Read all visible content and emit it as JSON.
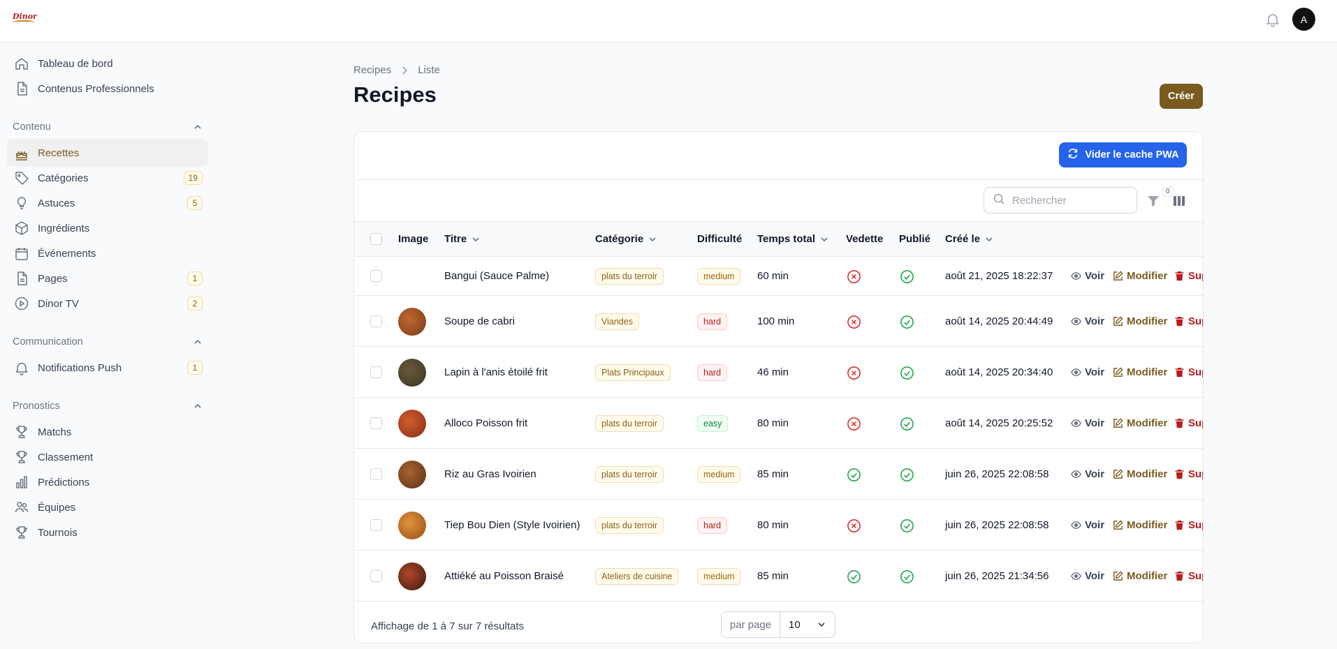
{
  "app": {
    "logo_text": "Dinor",
    "avatar_initial": "A"
  },
  "sidebar": {
    "top_items": [
      {
        "label": "Tableau de bord",
        "icon": "home-icon"
      },
      {
        "label": "Contenus Professionnels",
        "icon": "document-icon"
      }
    ],
    "groups": [
      {
        "label": "Contenu",
        "items": [
          {
            "label": "Recettes",
            "icon": "cake-icon",
            "active": true
          },
          {
            "label": "Catégories",
            "icon": "tag-icon",
            "badge": "19"
          },
          {
            "label": "Astuces",
            "icon": "lightbulb-icon",
            "badge": "5"
          },
          {
            "label": "Ingrédients",
            "icon": "cube-icon"
          },
          {
            "label": "Événements",
            "icon": "calendar-icon"
          },
          {
            "label": "Pages",
            "icon": "document-icon",
            "badge": "1"
          },
          {
            "label": "Dinor TV",
            "icon": "play-icon",
            "badge": "2"
          }
        ]
      },
      {
        "label": "Communication",
        "items": [
          {
            "label": "Notifications Push",
            "icon": "bell-icon",
            "badge": "1"
          }
        ]
      },
      {
        "label": "Pronostics",
        "items": [
          {
            "label": "Matchs",
            "icon": "trophy-icon"
          },
          {
            "label": "Classement",
            "icon": "trophy-icon"
          },
          {
            "label": "Prédictions",
            "icon": "bar-chart-icon"
          },
          {
            "label": "Équipes",
            "icon": "users-icon"
          },
          {
            "label": "Tournois",
            "icon": "trophy-icon"
          }
        ]
      }
    ]
  },
  "breadcrumb": {
    "root": "Recipes",
    "current": "Liste"
  },
  "page": {
    "title": "Recipes",
    "create_label": "Créer"
  },
  "card": {
    "pwa_button": "Vider le cache PWA",
    "search_placeholder": "Rechercher",
    "filter_count": "0"
  },
  "table": {
    "headers": {
      "image": "Image",
      "title": "Titre",
      "category": "Catégorie",
      "difficulty": "Difficulté",
      "total_time": "Temps total",
      "featured": "Vedette",
      "published": "Publié",
      "created": "Créé le"
    },
    "action_labels": {
      "view": "Voir",
      "edit": "Modifier",
      "delete": "Supprimer"
    },
    "rows": [
      {
        "title": "Bangui (Sauce Palme)",
        "category": "plats du terroir",
        "difficulty": "medium",
        "time": "60 min",
        "featured": false,
        "published": true,
        "created": "août 21, 2025 18:22:37",
        "has_image": false,
        "img_colors": [
          "#ffffff",
          "#ffffff"
        ]
      },
      {
        "title": "Soupe de cabri",
        "category": "Viandes",
        "difficulty": "hard",
        "time": "100 min",
        "featured": false,
        "published": true,
        "created": "août 14, 2025 20:44:49",
        "has_image": true,
        "img_colors": [
          "#7a3a1a",
          "#c0682e"
        ]
      },
      {
        "title": "Lapin à l'anis étoilé frit",
        "category": "Plats Principaux",
        "difficulty": "hard",
        "time": "46 min",
        "featured": false,
        "published": true,
        "created": "août 14, 2025 20:34:40",
        "has_image": true,
        "img_colors": [
          "#3a3424",
          "#6b5a3a"
        ]
      },
      {
        "title": "Alloco Poisson frit",
        "category": "plats du terroir",
        "difficulty": "easy",
        "time": "80 min",
        "featured": false,
        "published": true,
        "created": "août 14, 2025 20:25:52",
        "has_image": true,
        "img_colors": [
          "#8a2a18",
          "#d0602a"
        ]
      },
      {
        "title": "Riz au Gras Ivoirien",
        "category": "plats du terroir",
        "difficulty": "medium",
        "time": "85 min",
        "featured": true,
        "published": true,
        "created": "juin 26, 2025 22:08:58",
        "has_image": true,
        "img_colors": [
          "#5a3018",
          "#a8642e"
        ]
      },
      {
        "title": "Tiep Bou Dien (Style Ivoirien)",
        "category": "plats du terroir",
        "difficulty": "hard",
        "time": "80 min",
        "featured": false,
        "published": true,
        "created": "juin 26, 2025 22:08:58",
        "has_image": true,
        "img_colors": [
          "#9a4a18",
          "#e0963a"
        ]
      },
      {
        "title": "Attiéké au Poisson Braisé",
        "category": "Ateliers de cuisine",
        "difficulty": "medium",
        "time": "85 min",
        "featured": true,
        "published": true,
        "created": "juin 26, 2025 21:34:56",
        "has_image": true,
        "img_colors": [
          "#3a1a10",
          "#b0482a"
        ]
      }
    ]
  },
  "footer": {
    "summary": "Affichage de 1 à 7 sur 7 résultats",
    "per_page_label": "par page",
    "per_page_value": "10"
  },
  "colors": {
    "brand": "#7a5a1e",
    "primary_blue": "#2563eb",
    "success": "#16a34a",
    "danger": "#dc2626"
  }
}
